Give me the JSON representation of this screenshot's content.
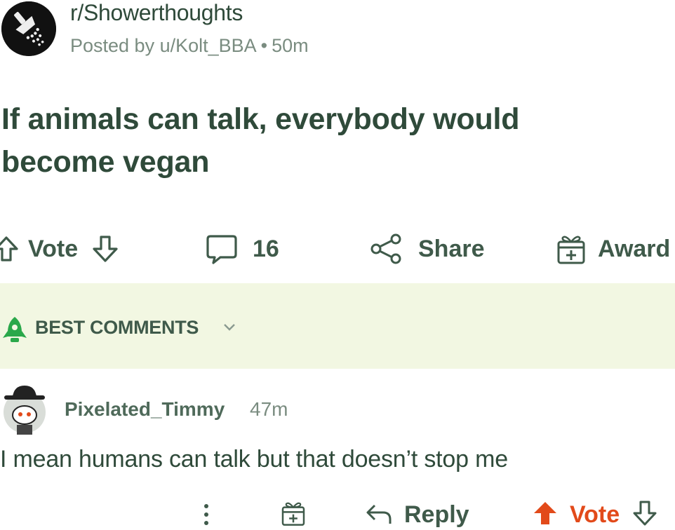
{
  "post": {
    "subreddit": "r/Showerthoughts",
    "posted_by": "Posted by u/Kolt_BBA",
    "separator": "•",
    "time": "50m",
    "title": "If animals can talk, everybody would become vegan"
  },
  "actions": {
    "vote_label": "Vote",
    "comment_count": "16",
    "share_label": "Share",
    "award_label": "Award"
  },
  "sort": {
    "label": "BEST COMMENTS"
  },
  "comment": {
    "author": "Pixelated_Timmy",
    "time": "47m",
    "body": "I mean humans can talk but that doesn’t stop me",
    "reply_label": "Reply",
    "vote_label": "Vote"
  },
  "colors": {
    "text": "#2f4a3a",
    "muted": "#7a8c80",
    "band": "#f2f7e2",
    "upvote_active": "#e24a1a",
    "sort_icon": "#2aa84a"
  },
  "icons": {
    "subreddit_avatar": "shower-head-icon",
    "upvote": "upvote-arrow-icon",
    "downvote": "downvote-arrow-icon",
    "comments": "speech-bubble-icon",
    "share": "share-icon",
    "award": "gift-box-icon",
    "sort": "rocket-icon",
    "chevron": "chevron-down-icon",
    "more": "more-vertical-icon",
    "reply": "reply-arrow-icon"
  }
}
